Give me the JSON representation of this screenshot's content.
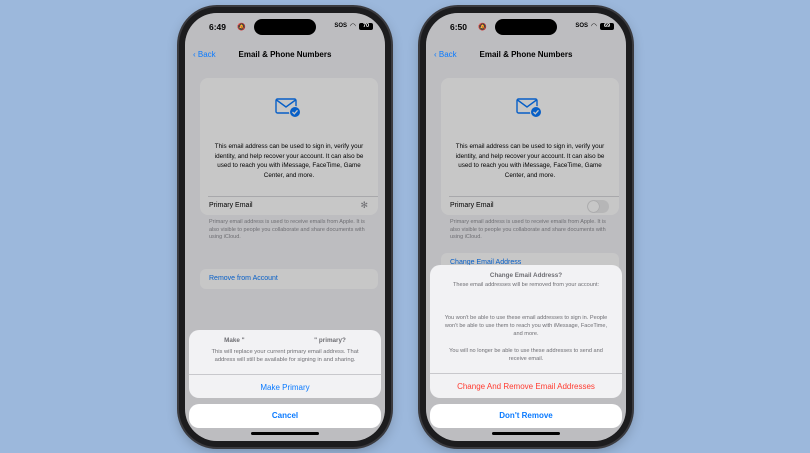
{
  "left": {
    "status": {
      "time": "6:49",
      "sos": "SOS",
      "battery": "70"
    },
    "nav": {
      "back": "Back",
      "title": "Email & Phone Numbers"
    },
    "card": {
      "description": "This email address can be used to sign in, verify your identity, and help recover your account. It can also be used to reach you with iMessage, FaceTime, Game Center, and more.",
      "primary_label": "Primary Email"
    },
    "footnote": "Primary email address is used to receive emails from Apple. It is also visible to people you collaborate and share documents with using iCloud.",
    "remove_link": "Remove from Account",
    "sheet": {
      "title_left": "Make \"",
      "title_right": "\" primary?",
      "message": "This will replace your current primary email address. That address will still be available for signing in and sharing.",
      "action": "Make Primary"
    },
    "cancel": "Cancel"
  },
  "right": {
    "status": {
      "time": "6:50",
      "sos": "SOS",
      "battery": "69"
    },
    "nav": {
      "back": "Back",
      "title": "Email & Phone Numbers"
    },
    "card": {
      "description": "This email address can be used to sign in, verify your identity, and help recover your account. It can also be used to reach you with iMessage, FaceTime, Game Center, and more.",
      "primary_label": "Primary Email"
    },
    "footnote": "Primary email address is used to receive emails from Apple. It is also visible to people you collaborate and share documents with using iCloud.",
    "change_link": "Change Email Address",
    "sheet": {
      "title": "Change Email Address?",
      "subtitle": "These email addresses will be removed from your account:",
      "message1": "You won't be able to use these email addresses to sign in. People won't be able to use them to reach you with iMessage, FaceTime, and more.",
      "message2": "You will no longer be able to use these addresses to send and receive email.",
      "action": "Change And Remove Email Addresses"
    },
    "cancel": "Don't Remove"
  },
  "colors": {
    "accent": "#0a7aff",
    "destructive": "#ff3b30",
    "background": "#9cb8dc"
  }
}
